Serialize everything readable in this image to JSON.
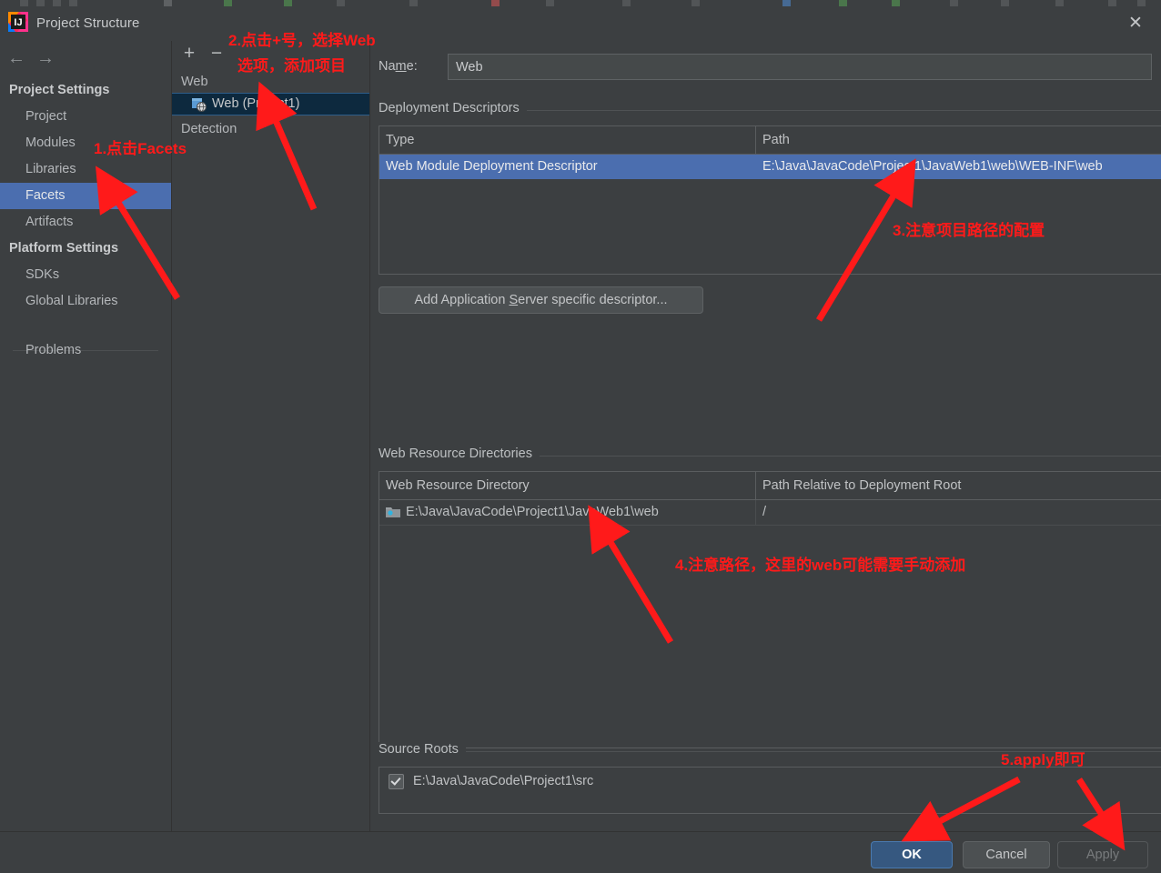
{
  "window": {
    "title": "Project Structure",
    "app_icon": "intellij-idea-icon",
    "close_label": "✕"
  },
  "nav": {
    "back_icon": "←",
    "forward_icon": "→"
  },
  "sidebar": {
    "groups": [
      {
        "label": "Project Settings"
      },
      {
        "label": "Platform Settings"
      }
    ],
    "items": [
      {
        "label": "Project",
        "selected": false
      },
      {
        "label": "Modules",
        "selected": false
      },
      {
        "label": "Libraries",
        "selected": false
      },
      {
        "label": "Facets",
        "selected": true
      },
      {
        "label": "Artifacts",
        "selected": false
      },
      {
        "label": "SDKs",
        "selected": false
      },
      {
        "label": "Global Libraries",
        "selected": false
      },
      {
        "label": "Problems",
        "selected": false
      }
    ],
    "help_label": "?"
  },
  "facets": {
    "toolbar": {
      "add_label": "+",
      "remove_label": "−"
    },
    "group_web": "Web",
    "selected_node": "Web (Project1)",
    "group_detection": "Detection"
  },
  "detail": {
    "name_label_pre": "Na",
    "name_label_mnemonic": "m",
    "name_label_post": "e:",
    "name_value": "Web",
    "deployment_descriptors": {
      "section_title": "Deployment Descriptors",
      "columns": [
        "Type",
        "Path"
      ],
      "rows": [
        {
          "type": "Web Module Deployment Descriptor",
          "path": "E:\\Java\\JavaCode\\Project1\\JavaWeb1\\web\\WEB-INF\\web",
          "selected": true
        }
      ],
      "toolbar": [
        "+",
        "−",
        "pencil-icon"
      ],
      "add_button_pre": "Add Application ",
      "add_button_mnemonic": "S",
      "add_button_post": "erver specific descriptor..."
    },
    "web_resource_directories": {
      "section_title": "Web Resource Directories",
      "columns": [
        "Web Resource Directory",
        "Path Relative to Deployment Root"
      ],
      "rows": [
        {
          "directory": "E:\\Java\\JavaCode\\Project1\\JavaWeb1\\web",
          "relative": "/"
        }
      ],
      "toolbar": [
        "+",
        "−",
        "pencil-icon",
        "?"
      ]
    },
    "source_roots": {
      "section_title": "Source Roots",
      "items": [
        {
          "checked": true,
          "path": "E:\\Java\\JavaCode\\Project1\\src"
        }
      ]
    }
  },
  "buttons": {
    "ok": "OK",
    "cancel": "Cancel",
    "apply": "Apply"
  },
  "annotations": [
    {
      "id": "a1",
      "text": "1.点击Facets"
    },
    {
      "id": "a2",
      "line1": "2.点击+号，选择Web",
      "line2": "选项，添加项目"
    },
    {
      "id": "a3",
      "text": "3.注意项目路径的配置"
    },
    {
      "id": "a4",
      "text": "4.注意路径，这里的web可能需要手动添加"
    },
    {
      "id": "a5",
      "text": "5.apply即可"
    }
  ],
  "colors": {
    "background": "#3c3f41",
    "selection_blue": "#4b6eaf",
    "tree_selection": "#0d293e",
    "primary_button": "#365880",
    "annotation_red": "#ff1a1a"
  }
}
